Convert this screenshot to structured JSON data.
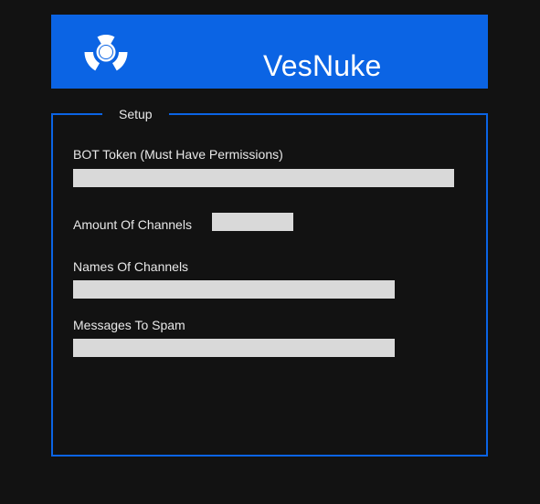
{
  "header": {
    "title": "VesNuke",
    "logo_icon": "radiation-icon",
    "background_color": "#0b64e4"
  },
  "setup": {
    "legend": "Setup",
    "border_color": "#0b64e4",
    "bot_token": {
      "label": "BOT Token (Must Have Permissions)",
      "value": ""
    },
    "channel_amount": {
      "label": "Amount Of Channels",
      "value": ""
    },
    "channel_names": {
      "label": "Names Of Channels",
      "value": ""
    },
    "spam_messages": {
      "label": "Messages To Spam",
      "value": ""
    }
  }
}
